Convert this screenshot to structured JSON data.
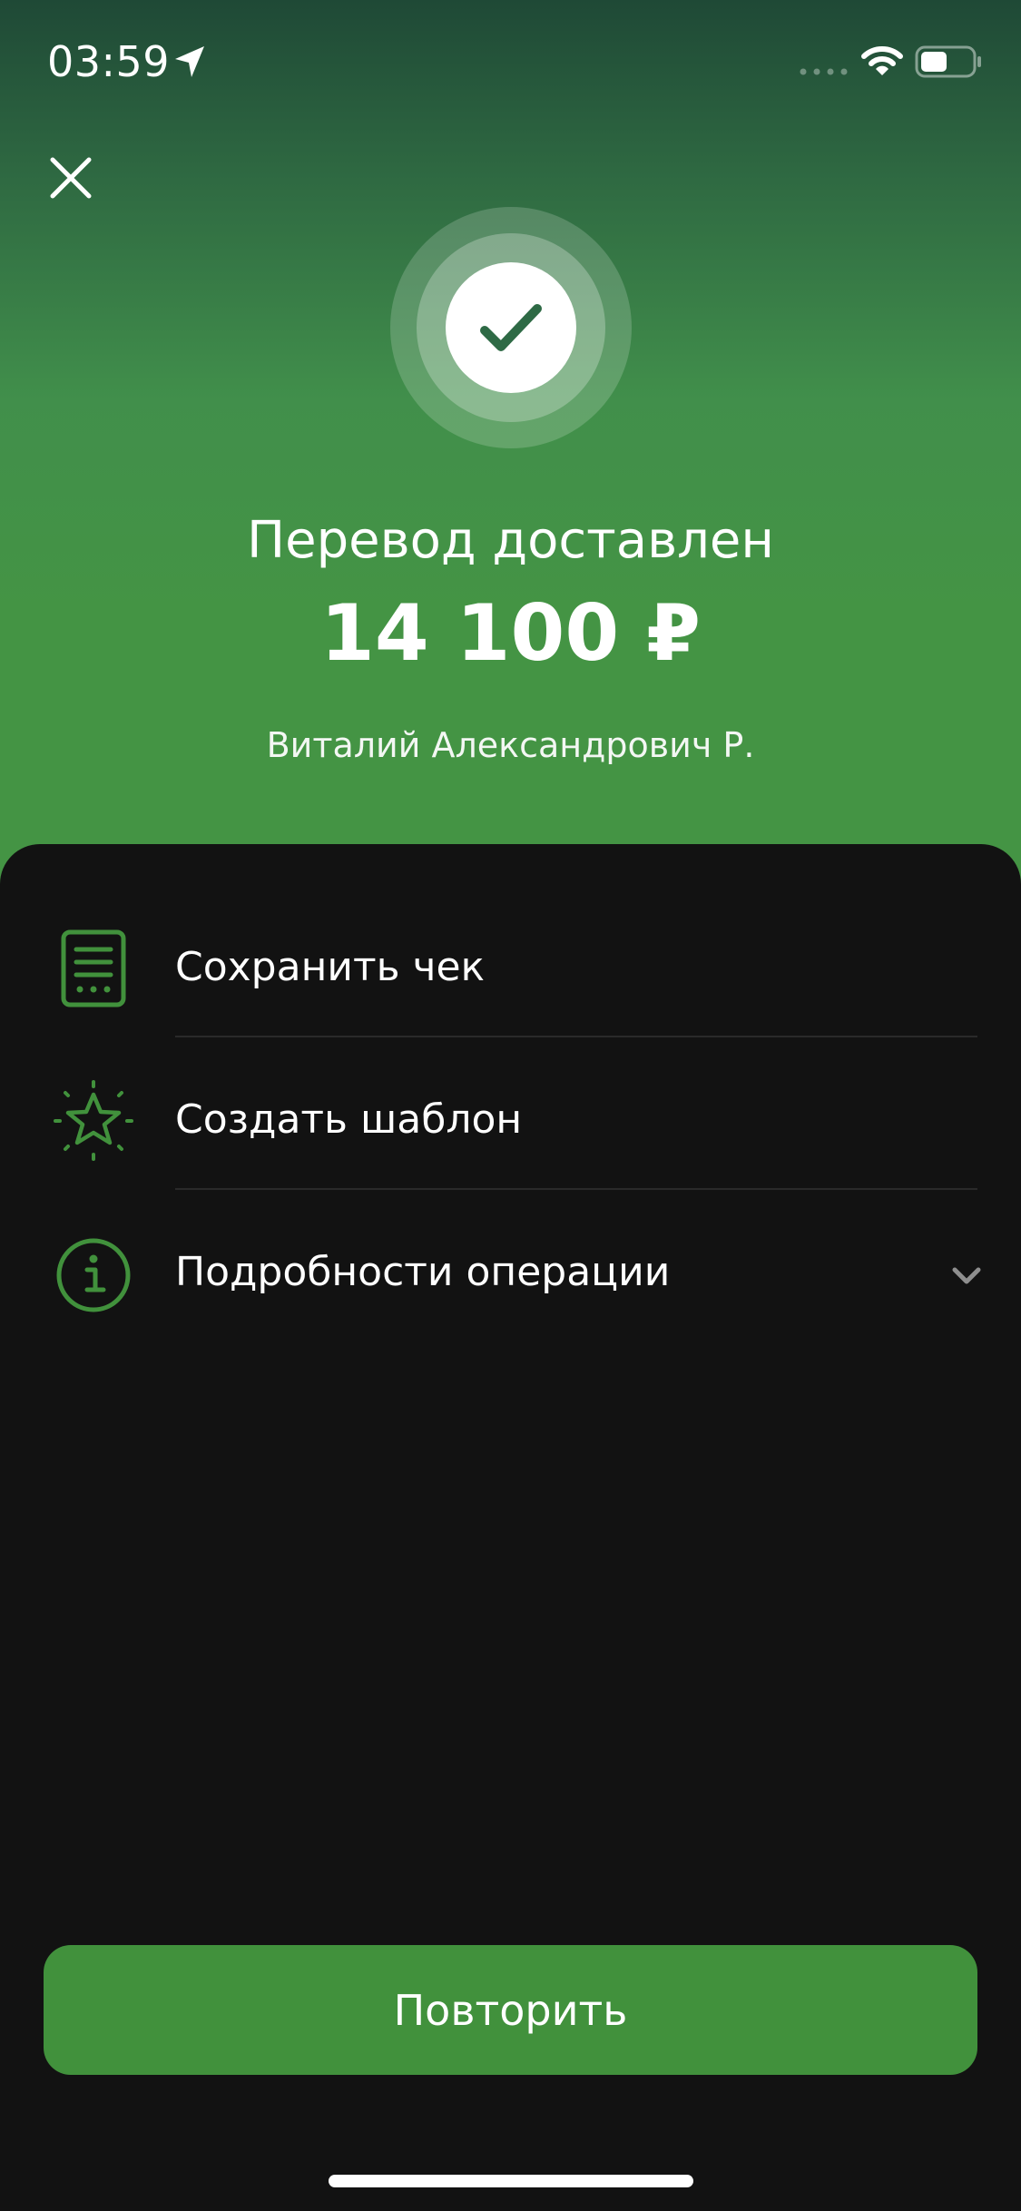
{
  "status_bar": {
    "time": "03:59",
    "icons": [
      "location-arrow-icon",
      "cellular-signal-icon",
      "wifi-icon",
      "battery-icon"
    ]
  },
  "header": {
    "close_icon": "close-icon",
    "success_icon": "checkmark-icon",
    "title": "Перевод доставлен",
    "amount": "14 100 ₽",
    "recipient": "Виталий Александрович Р."
  },
  "actions": [
    {
      "label": "Сохранить чек",
      "icon": "receipt-icon"
    },
    {
      "label": "Создать шаблон",
      "icon": "star-icon"
    },
    {
      "label": "Подробности операции",
      "icon": "info-icon",
      "expand_icon": "chevron-down-icon"
    }
  ],
  "footer": {
    "repeat_label": "Повторить"
  },
  "colors": {
    "accent_green": "#41913c",
    "sheet_background": "#121212",
    "gradient_top": "#1f4936",
    "gradient_bottom": "#449444"
  }
}
